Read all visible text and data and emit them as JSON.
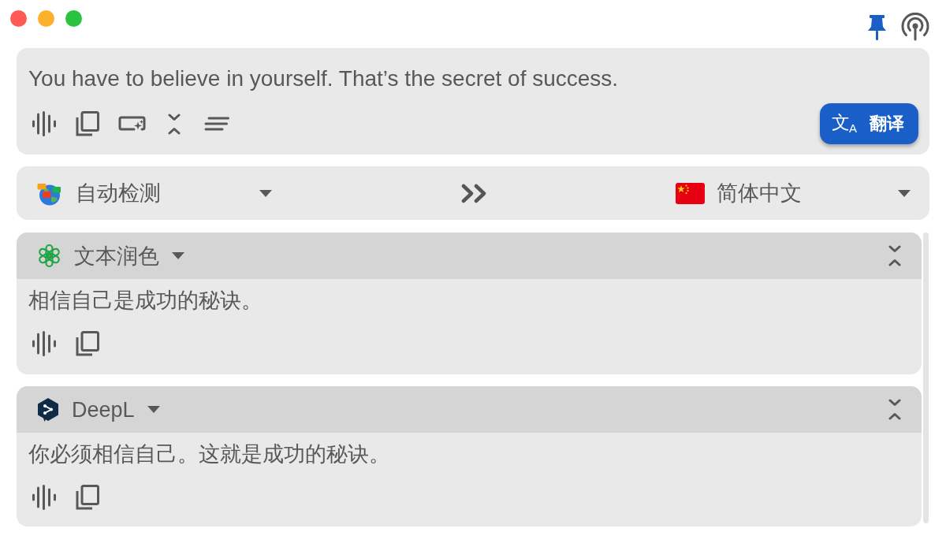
{
  "window": {
    "pinned": true
  },
  "source": {
    "text": "You have to believe in yourself. That’s the secret of success.",
    "translate_button": {
      "icon": "文$_{A}$",
      "label": "翻译"
    }
  },
  "languages": {
    "source": {
      "label": "自动检测"
    },
    "target": {
      "label": "简体中文"
    }
  },
  "results": [
    {
      "kind": "openai",
      "service": "文本润色",
      "expanded": true,
      "text": "相信自己是成功的秘诀。"
    },
    {
      "kind": "deepl",
      "service": "DeepL",
      "expanded": true,
      "text": "你必须相信自己。这就是成功的秘诀。"
    }
  ]
}
